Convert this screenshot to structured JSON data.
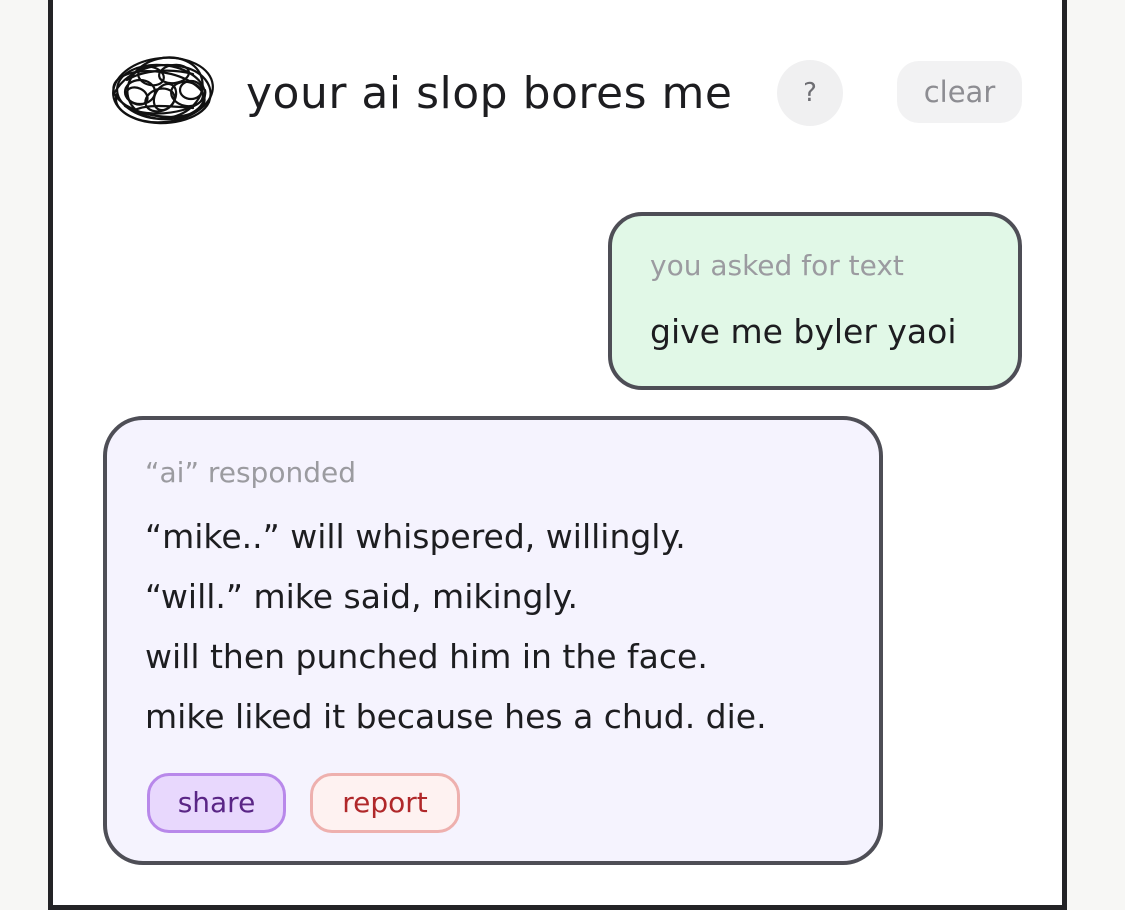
{
  "header": {
    "title": "your ai slop bores me",
    "help_label": "?",
    "clear_label": "clear",
    "logo_icon": "scribble-logo-icon"
  },
  "user_message": {
    "caption": "you asked for text",
    "text": "give me byler yaoi"
  },
  "ai_message": {
    "caption": "“ai” responded",
    "lines": [
      "“mike..” will whispered, willingly.",
      "“will.” mike said, mikingly.",
      "will then punched him in the face.",
      "mike liked it because hes a chud. die."
    ],
    "share_label": "share",
    "report_label": "report"
  },
  "colors": {
    "user_bubble": "#e1f8e7",
    "ai_bubble": "#f5f3fe",
    "share": "#e8d8fd",
    "report": "#fef2f1"
  }
}
